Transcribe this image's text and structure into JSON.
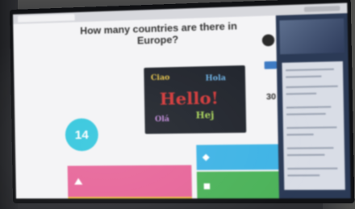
{
  "question": {
    "text": "How many countries are there in Europe?"
  },
  "timer": {
    "value": "14"
  },
  "answers_count": {
    "value": "30"
  },
  "image_words": [
    "Hello!",
    "Ciao",
    "Hola",
    "Hej",
    "Olá"
  ],
  "colors": {
    "timer": "#35c7de",
    "answer_red": "#e7669a",
    "answer_blue": "#3fb4e6",
    "answer_green": "#4cb35a",
    "answer_yellow": "#efbe4a"
  },
  "answers": [
    {
      "shape": "triangle-icon"
    },
    {
      "shape": "diamond-icon"
    },
    {
      "shape": "circle-icon"
    },
    {
      "shape": "square-icon"
    }
  ]
}
